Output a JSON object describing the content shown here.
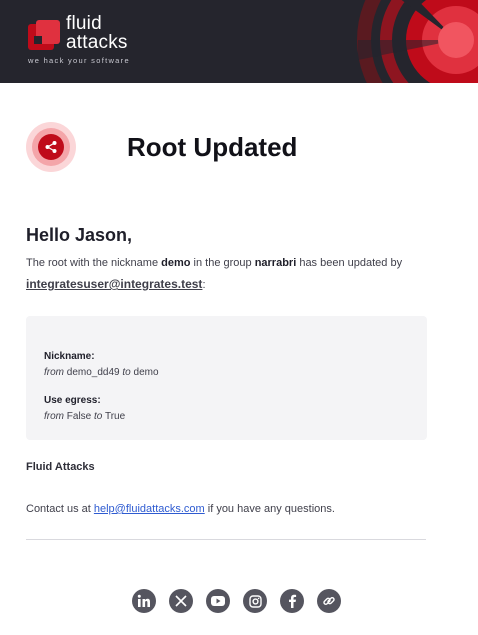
{
  "header": {
    "brand_line1": "fluid",
    "brand_line2": "attacks",
    "tagline": "we hack your software",
    "colors": {
      "background": "#25252d",
      "accent": "#bf0b1a"
    }
  },
  "title": {
    "icon": "share-icon",
    "text": "Root Updated"
  },
  "greeting": "Hello Jason,",
  "intro": {
    "part1": "The root with the nickname ",
    "nickname": "demo",
    "part2": " in the group ",
    "group": "narrabri",
    "part3": " has been updated by",
    "email": "integratesuser@integrates.test",
    "suffix": ":"
  },
  "changes": [
    {
      "label": "Nickname:",
      "from_word": "from",
      "from": "demo_dd49",
      "to_word": "to",
      "to": "demo"
    },
    {
      "label": "Use egress:",
      "from_word": "from",
      "from": "False",
      "to_word": "to",
      "to": "True"
    }
  ],
  "signature": "Fluid Attacks",
  "contact": {
    "before": "Contact us at ",
    "link": "help@fluidattacks.com",
    "after": " if you have any questions."
  },
  "social": [
    "linkedin-icon",
    "x-icon",
    "youtube-icon",
    "instagram-icon",
    "facebook-icon",
    "link-icon"
  ]
}
